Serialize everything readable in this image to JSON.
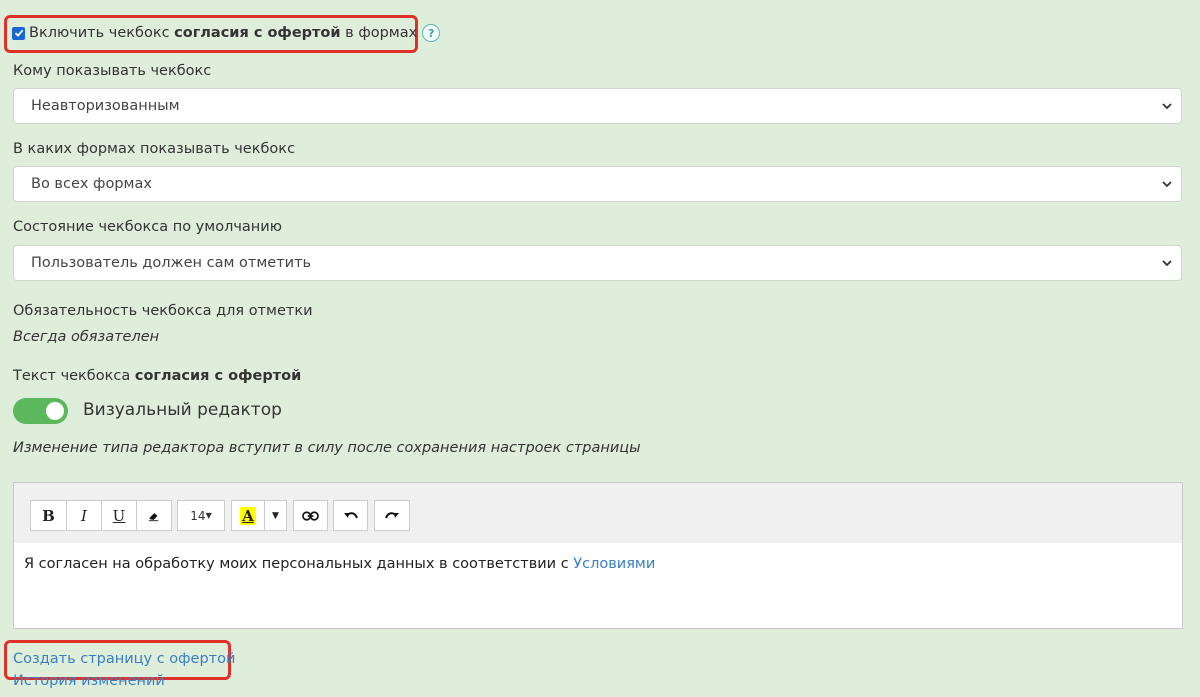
{
  "enable_checkbox": {
    "text_before": "Включить чекбокс",
    "text_bold": "согласия с офертой",
    "text_after": "в формах",
    "checked": true,
    "help_glyph": "?"
  },
  "who_label": "Кому показывать чекбокс",
  "who_value": "Неавторизованным",
  "forms_label": "В каких формах показывать чекбокс",
  "forms_value": "Во всех формах",
  "state_label": "Состояние чекбокса по умолчанию",
  "state_value": "Пользователь должен сам отметить",
  "required_label": "Обязательность чекбокса для отметки",
  "required_value": "Всегда обязателен",
  "text_label_before": "Текст чекбокса",
  "text_label_bold": "согласия с офертой",
  "visual_editor": {
    "label": "Визуальный редактор",
    "on": true
  },
  "editor_note": "Изменение типа редактора вступит в силу после сохранения настроек страницы",
  "toolbar": {
    "bold": "B",
    "italic": "I",
    "underline": "U",
    "font_size": "14",
    "color_letter": "A"
  },
  "editor_content": {
    "text": "Я согласен на обработку моих персональных данных в соответствии с",
    "link": "Условиями"
  },
  "create_link": "Создать страницу с офертой",
  "history_link": "История изменений",
  "colors": {
    "background": "#dfeedb",
    "highlight_red": "#e0302a",
    "toggle_green": "#5cb85c",
    "link_blue": "#3a7fc3"
  }
}
